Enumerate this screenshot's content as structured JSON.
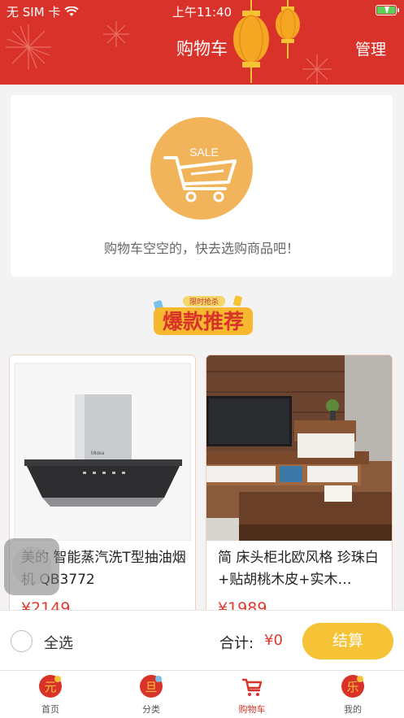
{
  "status_bar": {
    "carrier": "无 SIM 卡",
    "time": "上午11:40"
  },
  "header": {
    "title": "购物车",
    "manage": "管理"
  },
  "empty_cart": {
    "badge": "SALE",
    "message": "购物车空空的，快去选购商品吧！"
  },
  "banner": {
    "small": "限时抢杀",
    "main": "爆款推荐"
  },
  "products": [
    {
      "title": "美的 智能蒸汽洗T型抽油烟机 QB3772",
      "price": "¥2149",
      "brand": "Midea"
    },
    {
      "title": "简 床头柜北欧风格 珍珠白+贴胡桃木皮+实木…",
      "price": "¥1989"
    }
  ],
  "checkout": {
    "select_all": "全选",
    "total_label": "合计:",
    "total_value": "¥0",
    "settle": "结算"
  },
  "tabs": [
    {
      "label": "首页",
      "icon": "home-icon"
    },
    {
      "label": "分类",
      "icon": "category-icon"
    },
    {
      "label": "购物车",
      "icon": "cart-icon"
    },
    {
      "label": "我的",
      "icon": "profile-icon"
    }
  ],
  "colors": {
    "primary": "#d8322a",
    "accent": "#f6c337",
    "price": "#e03a2f"
  }
}
